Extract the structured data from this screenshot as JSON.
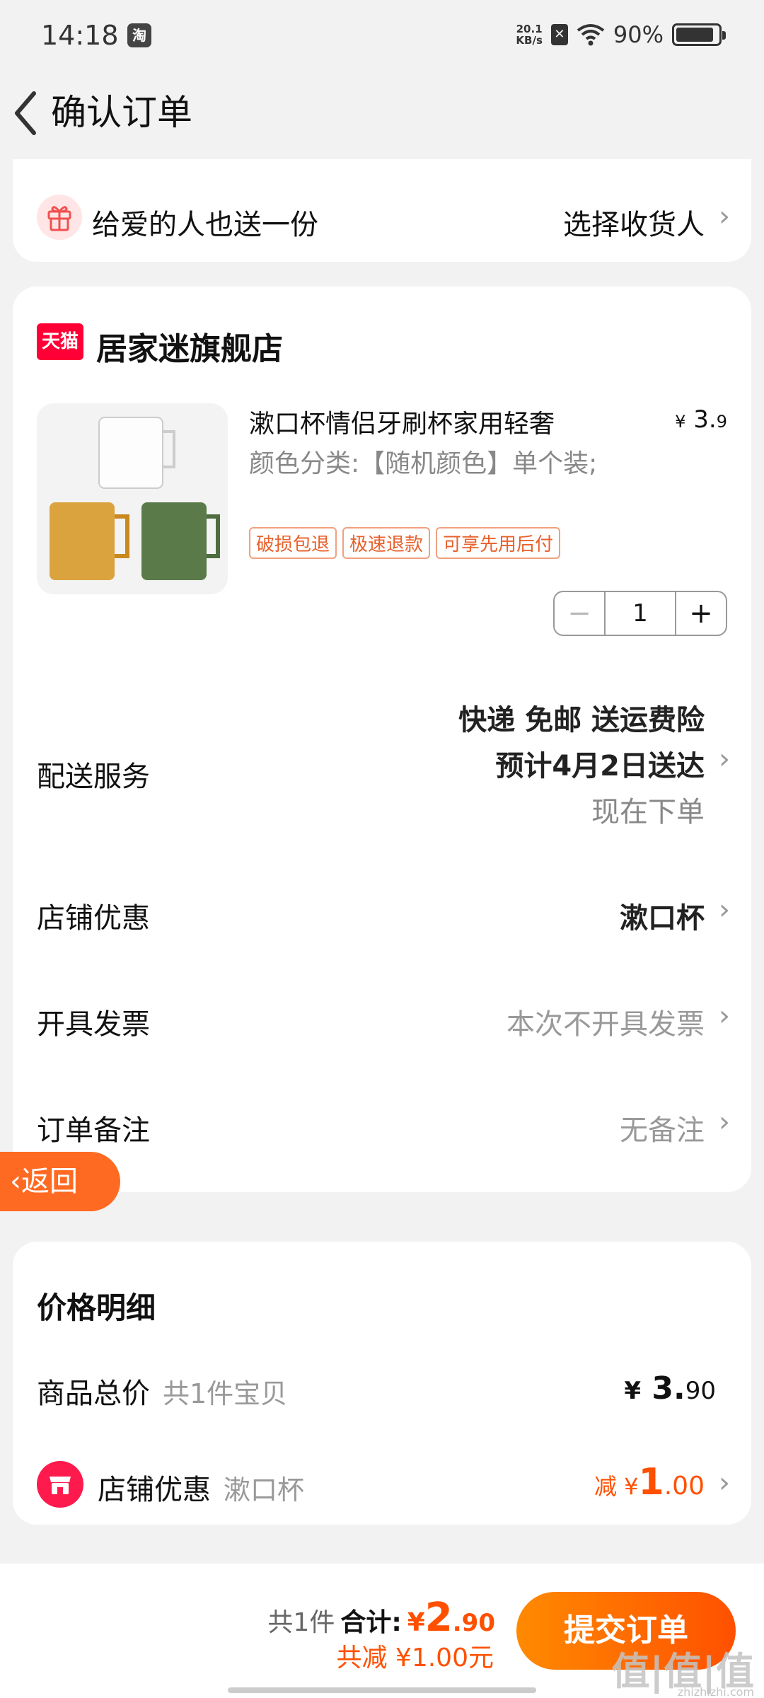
{
  "status_bar": {
    "time": "14:18",
    "app_icon": "淘",
    "net_speed_value": "20.1",
    "net_speed_unit": "KB/s",
    "sim": "✕",
    "battery": "90%"
  },
  "header": {
    "title": "确认订单"
  },
  "gift": {
    "text": "给爱的人也送一份",
    "action": "选择收货人"
  },
  "shop": {
    "badge": "天猫",
    "name": "居家迷旗舰店"
  },
  "product": {
    "title": "漱口杯情侣牙刷杯家用轻奢",
    "price_symbol": "¥",
    "price_int": "3.",
    "price_dec": "9",
    "spec": "颜色分类:【随机颜色】单个装;",
    "tags": [
      "破损包退",
      "极速退款",
      "可享先用后付"
    ],
    "quantity": "1",
    "minus": "−",
    "plus": "+"
  },
  "delivery": {
    "label": "配送服务",
    "line1": "快递 免邮 送运费险",
    "line2": "预计4月2日送达",
    "line3": "现在下单"
  },
  "shop_discount": {
    "label": "店铺优惠",
    "value": "漱口杯"
  },
  "invoice": {
    "label": "开具发票",
    "value": "本次不开具发票"
  },
  "remark": {
    "label": "订单备注",
    "value": "无备注"
  },
  "float_back": "返回",
  "price_detail": {
    "heading": "价格明细",
    "goods_label": "商品总价",
    "goods_sub": "共1件宝贝",
    "goods_symbol": "¥",
    "goods_int": "3.",
    "goods_dec": "90",
    "discount_label": "店铺优惠",
    "discount_sub": "漱口杯",
    "discount_prefix": "减 ¥",
    "discount_int": "1",
    "discount_dec": ".00"
  },
  "bottom": {
    "count": "共1件",
    "total_label": "合计:",
    "total_symbol": "¥",
    "total_int": "2",
    "total_dec": ".90",
    "saved": "共减 ¥1.00元",
    "submit": "提交订单",
    "watermark": "值|值|值",
    "watermark_sub": "zhizhizhi.com"
  },
  "colors": {
    "accent": "#ff5000",
    "tmall": "#ff0036",
    "tag": "#e8612c"
  }
}
